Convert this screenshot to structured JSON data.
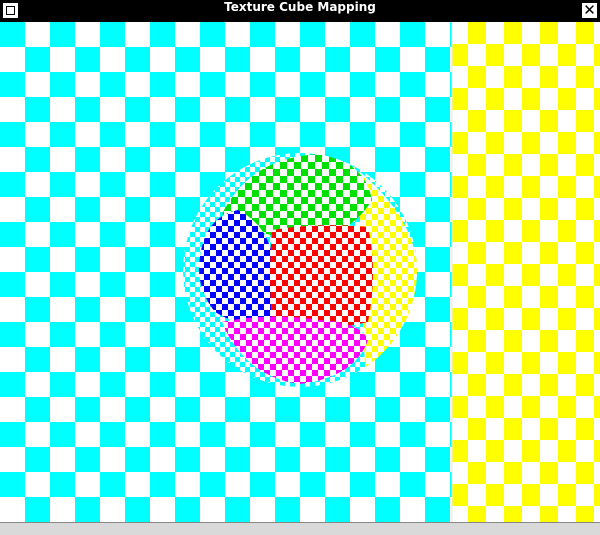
{
  "window": {
    "title": "Texture Cube Mapping",
    "menu_button_icon": "window-menu-icon",
    "close_button_icon": "close-icon"
  },
  "scene": {
    "description_colors": {
      "wall_left": "#00ffff",
      "wall_right": "#ffff00",
      "checker_light": "#ffffff",
      "sphere_green": "#00e000",
      "sphere_blue": "#0000ff",
      "sphere_red": "#ff0000",
      "sphere_magenta": "#ff00ff",
      "sphere_yellow": "#ffff00",
      "sphere_cyan": "#00ffff"
    }
  }
}
